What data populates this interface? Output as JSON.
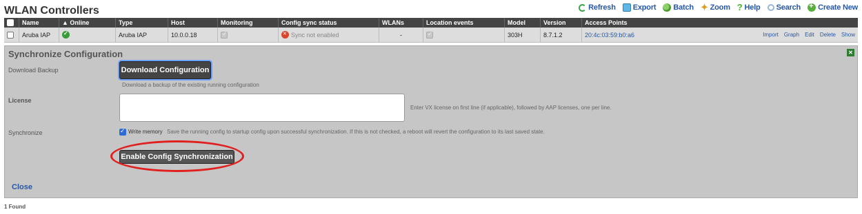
{
  "page": {
    "title": "WLAN Controllers",
    "found": "1 Found"
  },
  "actions": [
    {
      "label": "Refresh",
      "icon": "refresh-icon"
    },
    {
      "label": "Export",
      "icon": "export-icon"
    },
    {
      "label": "Batch",
      "icon": "batch-icon"
    },
    {
      "label": "Zoom",
      "icon": "zoom-icon"
    },
    {
      "label": "Help",
      "icon": "help-icon"
    },
    {
      "label": "Search",
      "icon": "search-icon"
    },
    {
      "label": "Create New",
      "icon": "create-new-icon"
    }
  ],
  "table": {
    "columns": [
      "Name",
      "Online",
      "Type",
      "Host",
      "Monitoring",
      "Config sync status",
      "WLANs",
      "Location events",
      "Model",
      "Version",
      "Access Points"
    ],
    "row": {
      "name": "Aruba IAP",
      "type": "Aruba IAP",
      "host": "10.0.0.18",
      "sync_status": "Sync not enabled",
      "wlans": "-",
      "model": "303H",
      "version": "8.7.1.2",
      "access_points": "20:4c:03:59:b0:a6",
      "links": [
        "Import",
        "Graph",
        "Edit",
        "Delete",
        "Show"
      ]
    }
  },
  "panel": {
    "title": "Synchronize Configuration",
    "download_label": "Download Backup",
    "download_button": "Download Configuration",
    "download_hint": "Download a backup of the existing running configuration",
    "license_label": "License",
    "license_value": "",
    "license_hint": "Enter VX license on first line (if applicable), followed by AAP licenses, one per line.",
    "sync_label": "Synchronize",
    "write_memory_label": "Write memory",
    "write_memory_checked": true,
    "write_memory_desc": "Save the running config to startup config upon successful synchronization. If this is not checked, a reboot will revert the configuration to its last saved state.",
    "enable_button": "Enable Config Synchronization",
    "close": "Close"
  },
  "colors": {
    "accent": "#2557a7",
    "highlight": "#e0201f"
  }
}
